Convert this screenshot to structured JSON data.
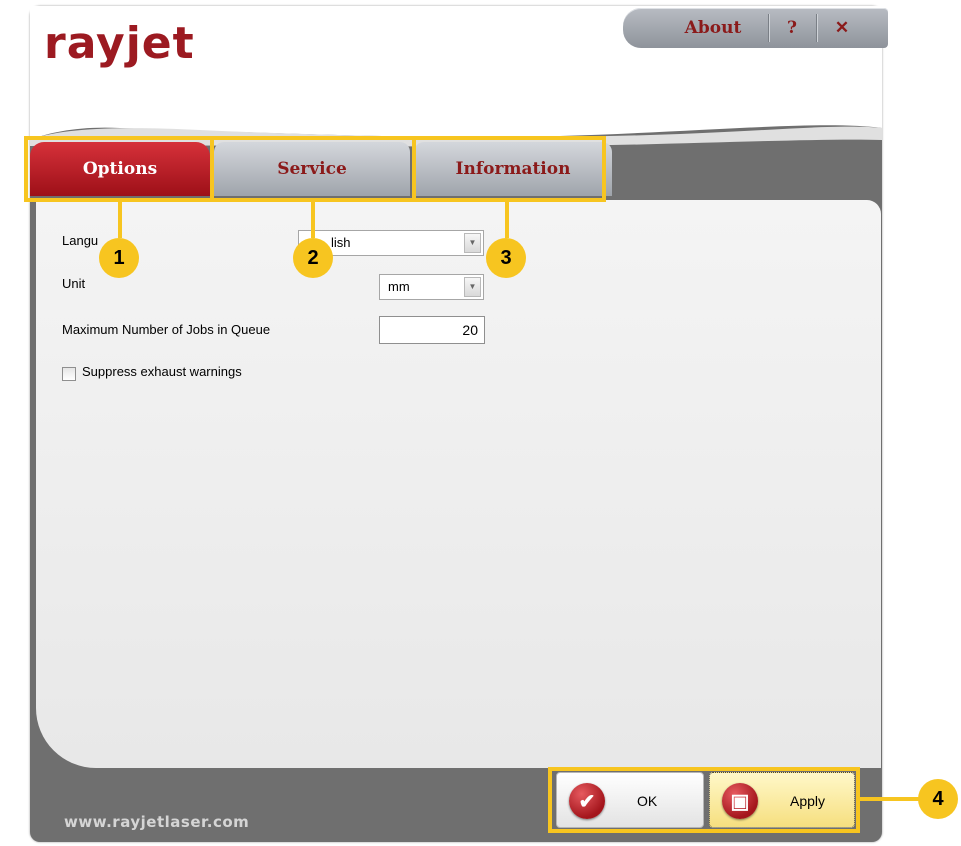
{
  "app": {
    "logo_text": "rayjet",
    "website": "www.rayjetlaser.com"
  },
  "titlebar": {
    "about_label": "About",
    "help_label": "?",
    "close_label": "✕"
  },
  "tabs": [
    {
      "label": "Options",
      "active": true
    },
    {
      "label": "Service",
      "active": false
    },
    {
      "label": "Information",
      "active": false
    }
  ],
  "options": {
    "language_label": "Langu",
    "language_value": "lish",
    "unit_label": "Unit",
    "unit_value": "mm",
    "max_jobs_label": "Maximum Number of Jobs in Queue",
    "max_jobs_value": "20",
    "suppress_label": "Suppress exhaust warnings",
    "suppress_checked": false
  },
  "buttons": {
    "ok_label": "OK",
    "apply_label": "Apply"
  },
  "callouts": [
    "1",
    "2",
    "3",
    "4"
  ],
  "colors": {
    "brand_red": "#9c1a21",
    "callout_yellow": "#f7c520",
    "frame_gray": "#6f6f6f"
  }
}
